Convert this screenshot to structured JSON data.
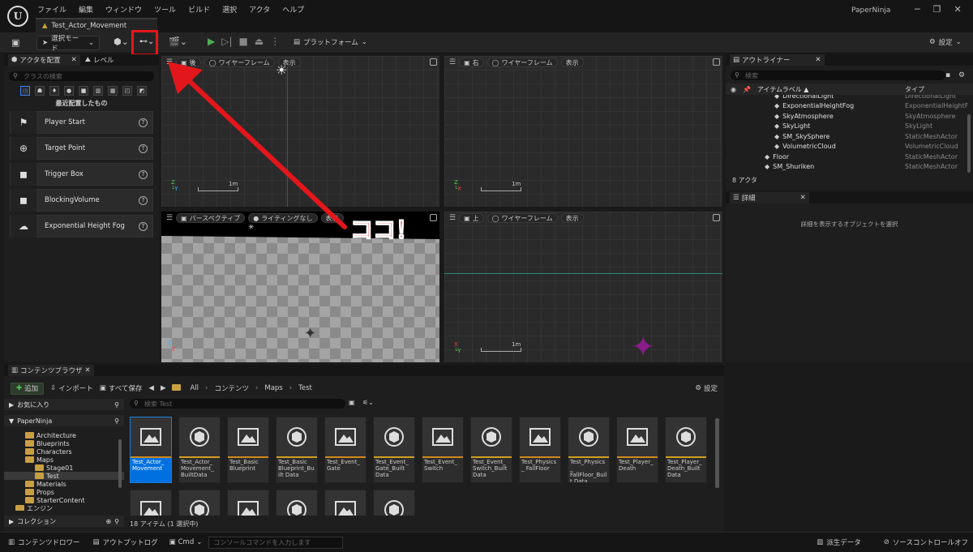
{
  "app": {
    "project_name": "PaperNinja",
    "document_tab": "Test_Actor_Movement",
    "logo": "unreal-logo"
  },
  "menu": [
    "ファイル",
    "編集",
    "ウィンドウ",
    "ツール",
    "ビルド",
    "選択",
    "アクタ",
    "ヘルプ"
  ],
  "toolbar": {
    "select_mode": "選択モード",
    "platform": "プラットフォーム",
    "settings": "設定"
  },
  "left_panel": {
    "tab_place": "アクタを配置",
    "tab_level": "レベル",
    "search_placeholder": "クラスの検索",
    "recent": "最近配置したもの",
    "actors": [
      {
        "name": "Player Start",
        "icon": "flag-icon"
      },
      {
        "name": "Target Point",
        "icon": "crosshair-icon"
      },
      {
        "name": "Trigger Box",
        "icon": "cube-icon"
      },
      {
        "name": "BlockingVolume",
        "icon": "cube-icon"
      },
      {
        "name": "Exponential Height Fog",
        "icon": "cloud-icon"
      }
    ]
  },
  "viewports": {
    "back": {
      "view": "後",
      "mode": "ワイヤーフレーム",
      "show": "表示",
      "scale": "1m"
    },
    "right": {
      "view": "右",
      "mode": "ワイヤーフレーム",
      "show": "表示",
      "scale": "1m"
    },
    "persp": {
      "view": "パースペクティブ",
      "lighting": "ライティングなし",
      "show": "表示"
    },
    "top": {
      "view": "上",
      "mode": "ワイヤーフレーム",
      "show": "表示",
      "scale": "1m"
    }
  },
  "annotation": {
    "text": "ココ！",
    "color": "#e3171b"
  },
  "outliner": {
    "title": "アウトライナー",
    "search_placeholder": "検索",
    "col_label": "アイテムラベル ▲",
    "col_type": "タイプ",
    "rows": [
      {
        "name": "DirectionalLight",
        "type": "DirectionalLight",
        "indent": 1
      },
      {
        "name": "ExponentialHeightFog",
        "type": "ExponentialHeightF",
        "indent": 1
      },
      {
        "name": "SkyAtmosphere",
        "type": "SkyAtmosphere",
        "indent": 1
      },
      {
        "name": "SkyLight",
        "type": "SkyLight",
        "indent": 1
      },
      {
        "name": "SM_SkySphere",
        "type": "StaticMeshActor",
        "indent": 1
      },
      {
        "name": "VolumetricCloud",
        "type": "VolumetricCloud",
        "indent": 1
      },
      {
        "name": "Floor",
        "type": "StaticMeshActor",
        "indent": 0
      },
      {
        "name": "SM_Shuriken",
        "type": "StaticMeshActor",
        "indent": 0
      }
    ],
    "count": "8 アクタ"
  },
  "details": {
    "title": "詳細",
    "empty_msg": "詳細を表示するオブジェクトを選択"
  },
  "content_browser": {
    "tab": "コンテンツブラウザ",
    "add": "追加",
    "import": "インポート",
    "save_all": "すべて保存",
    "path": [
      "All",
      "コンテンツ",
      "Maps",
      "Test"
    ],
    "settings": "設定",
    "favorites": "お気に入り",
    "project": "PaperNinja",
    "search_placeholder": "検索 Test",
    "collections": "コレクション",
    "status": "18 アイテム (1 選択中)",
    "tree": [
      {
        "name": "Architecture",
        "indent": 1
      },
      {
        "name": "Blueprints",
        "indent": 1
      },
      {
        "name": "Characters",
        "indent": 1
      },
      {
        "name": "Maps",
        "indent": 1
      },
      {
        "name": "Stage01",
        "indent": 2
      },
      {
        "name": "Test",
        "indent": 2,
        "selected": true
      },
      {
        "name": "Materials",
        "indent": 1
      },
      {
        "name": "Props",
        "indent": 1
      },
      {
        "name": "StarterContent",
        "indent": 1
      },
      {
        "name": "エンジン",
        "indent": 0
      }
    ],
    "assets": [
      {
        "name": "Test_Actor_ Movement",
        "kind": "level",
        "selected": true
      },
      {
        "name": "Test_Actor_ Movement_ BuiltData",
        "kind": "data"
      },
      {
        "name": "Test_Basic Blueprint",
        "kind": "level"
      },
      {
        "name": "Test_Basic Blueprint_Built Data",
        "kind": "data"
      },
      {
        "name": "Test_Event_ Gate",
        "kind": "level"
      },
      {
        "name": "Test_Event_ Gate_Built Data",
        "kind": "data"
      },
      {
        "name": "Test_Event_ Switch",
        "kind": "level"
      },
      {
        "name": "Test_Event_ Switch_Built Data",
        "kind": "data"
      },
      {
        "name": "Test_Physics_ FallFloor",
        "kind": "level"
      },
      {
        "name": "Test_Physics_ FallFloor_Built Data",
        "kind": "data"
      },
      {
        "name": "Test_Player_ Death",
        "kind": "level"
      },
      {
        "name": "Test_Player_ Death_Built Data",
        "kind": "data"
      },
      {
        "name": "",
        "kind": "level"
      },
      {
        "name": "",
        "kind": "data"
      },
      {
        "name": "",
        "kind": "level"
      },
      {
        "name": "",
        "kind": "data"
      },
      {
        "name": "",
        "kind": "level"
      },
      {
        "name": "",
        "kind": "data"
      }
    ]
  },
  "statusbar": {
    "content_drawer": "コンテンツドロワー",
    "output_log": "アウトプットログ",
    "cmd": "Cmd",
    "console_placeholder": "コンソールコマンドを入力します",
    "derived": "派生データ",
    "source_control": "ソースコントロールオフ"
  }
}
